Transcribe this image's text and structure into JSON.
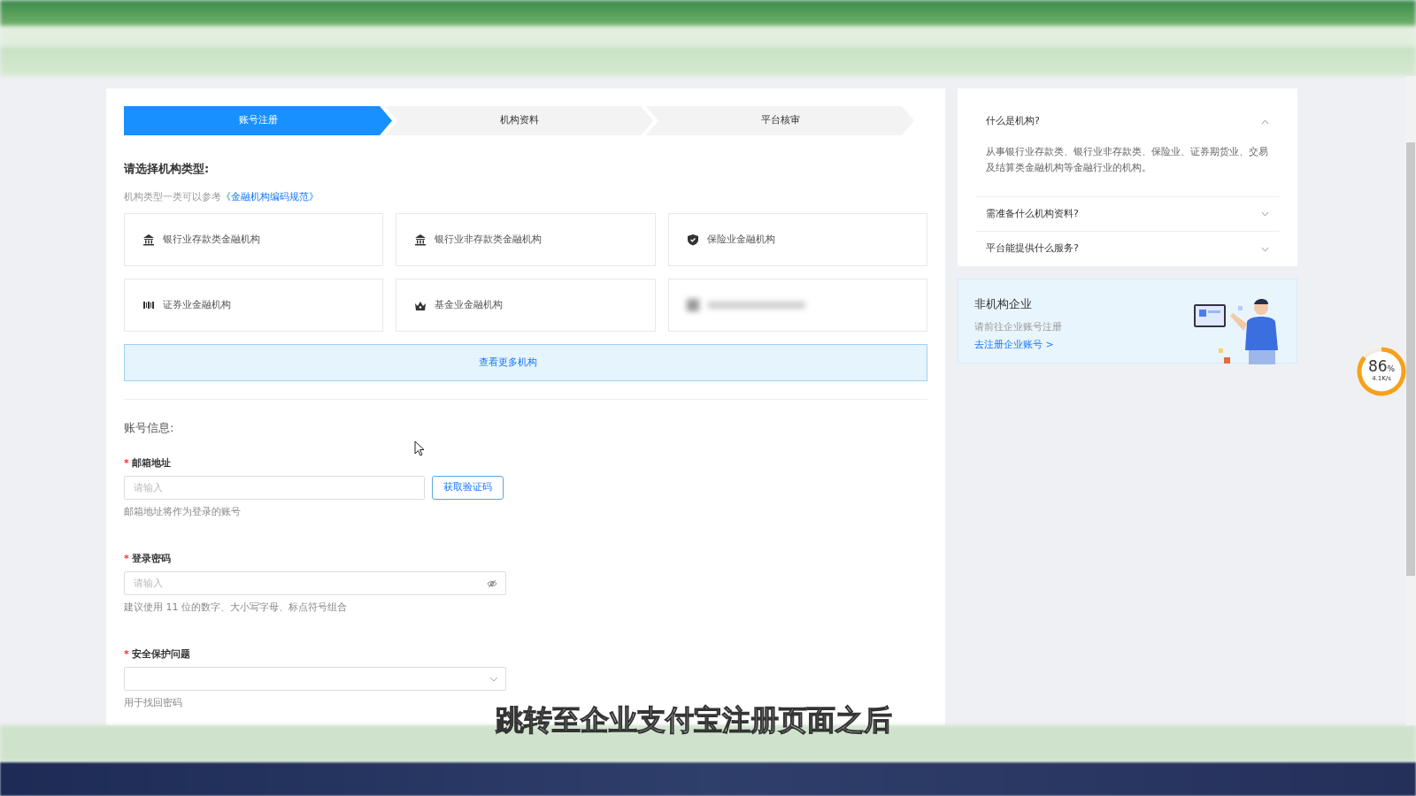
{
  "steps": [
    {
      "label": "账号注册",
      "selected": true
    },
    {
      "label": "机构资料",
      "selected": false
    },
    {
      "label": "平台核审",
      "selected": false
    }
  ],
  "type_section": {
    "title": "请选择机构类型:",
    "note": "机构类型一类可以参考",
    "note_link": "《金融机构编码规范》"
  },
  "institution_cards": [
    {
      "kind": "bank",
      "label": "银行业存款类金融机构"
    },
    {
      "kind": "bank",
      "label": "银行业非存款类金融机构"
    },
    {
      "kind": "shield",
      "label": "保险业金融机构"
    },
    {
      "kind": "securities",
      "label": "证券业金融机构"
    },
    {
      "kind": "fund",
      "label": "基金业金融机构"
    },
    {
      "kind": "blurred"
    }
  ],
  "more_button": "查看更多机构",
  "account_section": {
    "title": "账号信息:",
    "fields": [
      {
        "kind": "email",
        "label": "邮箱地址",
        "required_mark": "*",
        "placeholder": "请输入",
        "button": "获取验证码",
        "hint": "邮箱地址将作为登录的账号"
      },
      {
        "kind": "password",
        "label": "登录密码",
        "required_mark": "*",
        "placeholder": "请输入",
        "hint": "建议使用 11 位的数字、大小写字母、标点符号组合"
      },
      {
        "kind": "select",
        "label": "安全保护问题",
        "required_mark": "*",
        "hint": "用于找回密码"
      }
    ]
  },
  "faq": [
    {
      "question": "什么是机构?",
      "expanded": true,
      "answer": "从事银行业存款类、银行业非存款类、保险业、证券期货业、交易及结算类金融机构等金融行业的机构。"
    },
    {
      "question": "需准备什么机构资料?",
      "expanded": false
    },
    {
      "question": "平台能提供什么服务?",
      "expanded": false
    }
  ],
  "promo": {
    "title": "非机构企业",
    "text": "请前往企业账号注册",
    "link": "去注册企业账号 >"
  },
  "speed_widget": {
    "percent": "86",
    "unit": "%",
    "rate": "4.1K/s",
    "level": 0.86
  },
  "caption": "跳转至企业支付宝注册页面之后"
}
